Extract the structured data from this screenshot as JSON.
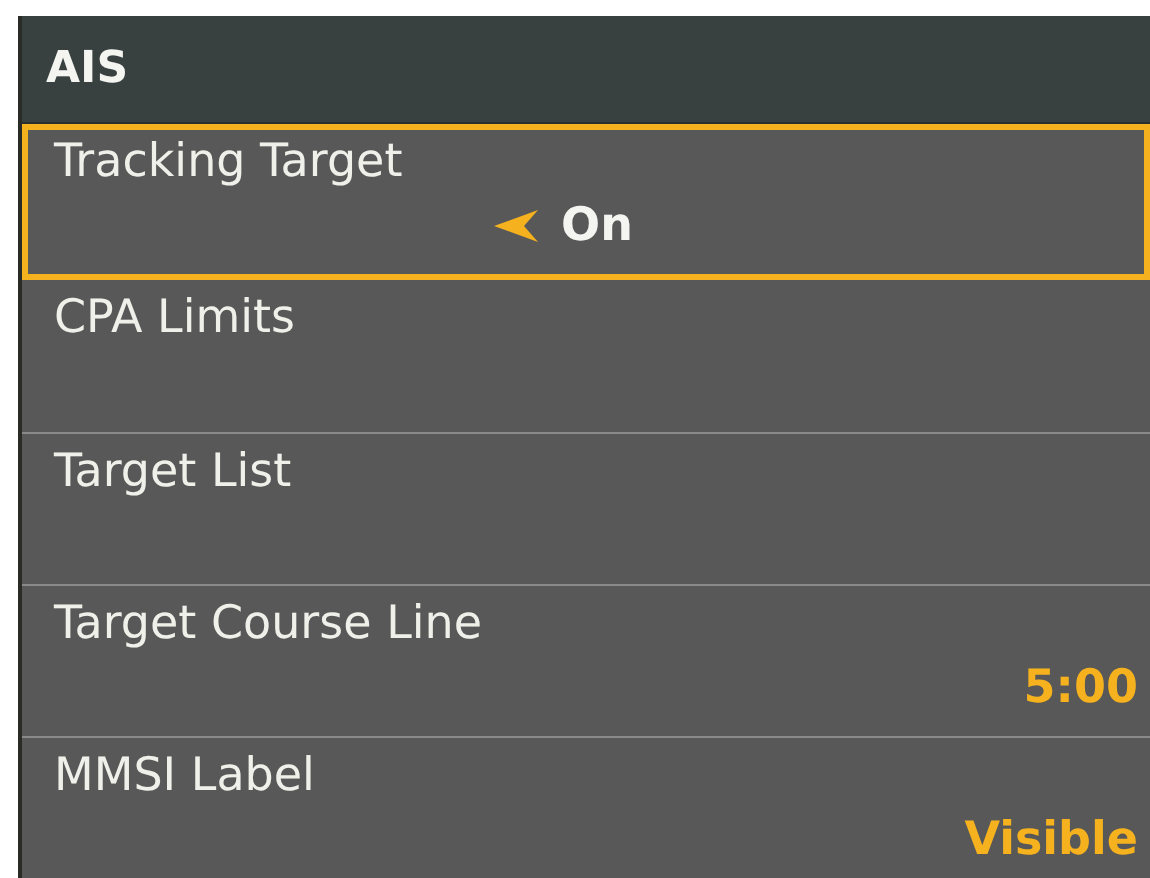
{
  "menu": {
    "title": "AIS",
    "items": [
      {
        "label": "Tracking Target",
        "value": "On",
        "selected": true
      },
      {
        "label": "CPA Limits",
        "selected": false
      },
      {
        "label": "Target List",
        "selected": false
      },
      {
        "label": "Target Course Line",
        "value": "5:00",
        "selected": false
      },
      {
        "label": "MMSI Label",
        "value": "Visible",
        "selected": false
      }
    ]
  }
}
